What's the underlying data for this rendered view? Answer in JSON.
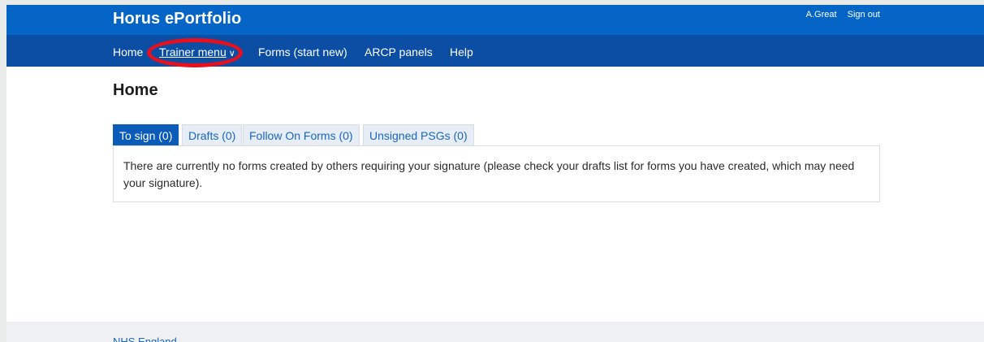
{
  "header": {
    "brand": "Horus ePortfolio",
    "user_name": "A.Great",
    "sign_out": "Sign out"
  },
  "nav": {
    "home": "Home",
    "trainer_menu": "Trainer menu",
    "trainer_menu_caret": "∨",
    "forms_start_new": "Forms (start new)",
    "arcp_panels": "ARCP panels",
    "help": "Help"
  },
  "page": {
    "title": "Home"
  },
  "tabs": [
    {
      "label": "To sign (0)",
      "active": true
    },
    {
      "label": "Drafts (0)",
      "active": false
    },
    {
      "label": "Follow On Forms (0)",
      "active": false
    },
    {
      "label": "Unsigned PSGs (0)",
      "active": false
    }
  ],
  "panel": {
    "message": "There are currently no forms created by others requiring your signature (please check your drafts list for forms you have created, which may need your signature)."
  },
  "footer": {
    "link": "NHS England"
  },
  "colors": {
    "topbar": "#0565c6",
    "navbar": "#0b4ea3",
    "annotation_ring": "#e8101c",
    "link": "#1a66c1"
  }
}
